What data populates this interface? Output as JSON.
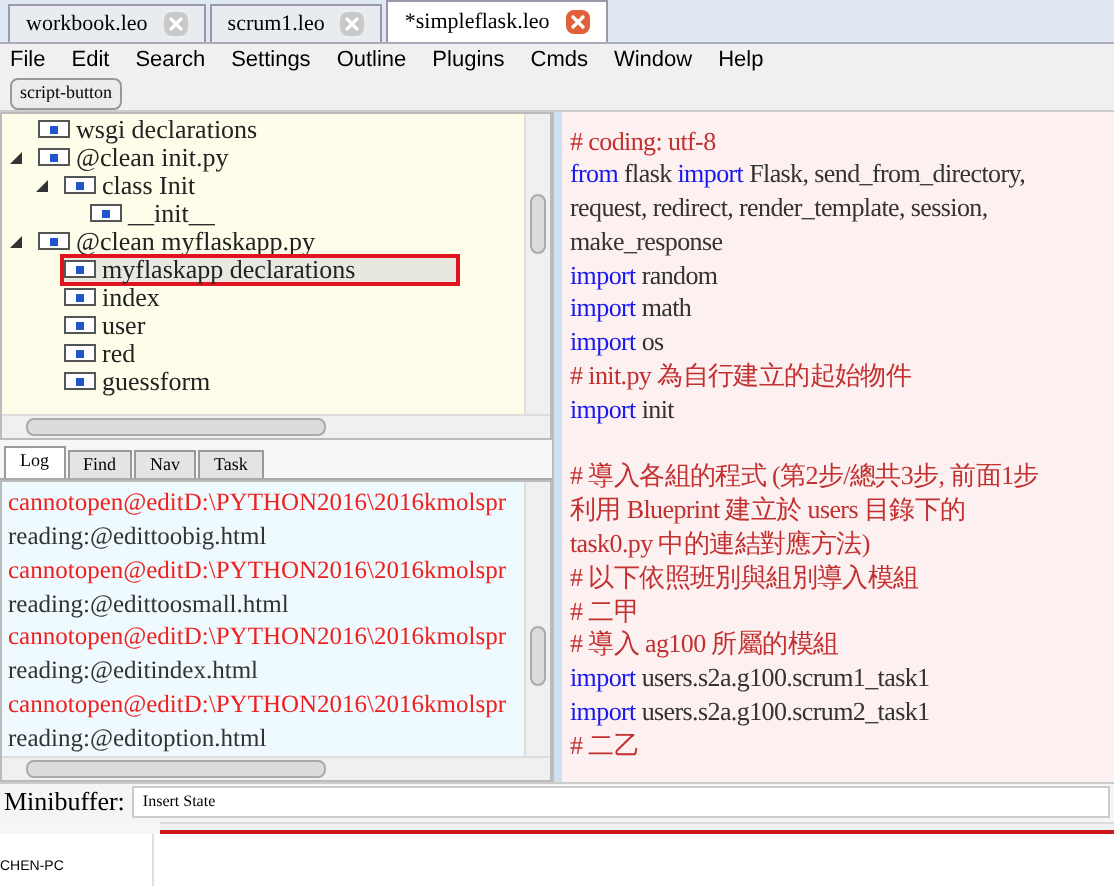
{
  "file_tabs": [
    {
      "label": "workbook.leo",
      "selected": false
    },
    {
      "label": "scrum1.leo",
      "selected": false
    },
    {
      "label": "*simpleflask.leo",
      "selected": true
    }
  ],
  "menu": [
    "File",
    "Edit",
    "Search",
    "Settings",
    "Outline",
    "Plugins",
    "Cmds",
    "Window",
    "Help"
  ],
  "toolbar": {
    "button": "script-button"
  },
  "outline": [
    {
      "label": "wsgi declarations",
      "selected": false
    },
    {
      "label": "@clean init.py",
      "selected": false,
      "expanded": true,
      "children": [
        {
          "label": "class Init",
          "selected": false,
          "expanded": true,
          "children": [
            {
              "label": "__init__",
              "selected": false
            }
          ]
        }
      ]
    },
    {
      "label": "@clean myflaskapp.py",
      "selected": false,
      "expanded": true,
      "children": [
        {
          "label": "myflaskapp declarations",
          "selected": true
        },
        {
          "label": "index",
          "selected": false
        },
        {
          "label": "user",
          "selected": false
        },
        {
          "label": "red",
          "selected": false
        },
        {
          "label": "guessform",
          "selected": false
        }
      ]
    }
  ],
  "log_tabs": [
    {
      "label": "Log",
      "selected": true
    },
    {
      "label": "Find",
      "selected": false
    },
    {
      "label": "Nav",
      "selected": false
    },
    {
      "label": "Task",
      "selected": false
    }
  ],
  "log": [
    {
      "kind": "error",
      "text": "cannotopen@editD:\\PYTHON2016\\2016kmolspr"
    },
    {
      "kind": "info",
      "text": "reading:@edittoobig.html"
    },
    {
      "kind": "error",
      "text": "cannotopen@editD:\\PYTHON2016\\2016kmolspr"
    },
    {
      "kind": "info",
      "text": "reading:@edittoosmall.html"
    },
    {
      "kind": "error",
      "text": "cannotopen@editD:\\PYTHON2016\\2016kmolspr"
    },
    {
      "kind": "info",
      "text": "reading:@editindex.html"
    },
    {
      "kind": "error",
      "text": "cannotopen@editD:\\PYTHON2016\\2016kmolspr"
    },
    {
      "kind": "info",
      "text": "reading:@editoption.html"
    }
  ],
  "code": [
    [
      {
        "kind": "comment",
        "text": "# coding: utf-8"
      }
    ],
    [
      {
        "kind": "keyword",
        "text": "from"
      },
      {
        "kind": "plain",
        "text": " flask "
      },
      {
        "kind": "keyword",
        "text": "import"
      },
      {
        "kind": "plain",
        "text": " Flask, send_from_directory,"
      }
    ],
    [
      {
        "kind": "plain",
        "text": "request, redirect, render_template, session,"
      }
    ],
    [
      {
        "kind": "plain",
        "text": "make_response"
      }
    ],
    [
      {
        "kind": "keyword",
        "text": "import"
      },
      {
        "kind": "plain",
        "text": " random"
      }
    ],
    [
      {
        "kind": "keyword",
        "text": "import"
      },
      {
        "kind": "plain",
        "text": " math"
      }
    ],
    [
      {
        "kind": "keyword",
        "text": "import"
      },
      {
        "kind": "plain",
        "text": " os"
      }
    ],
    [
      {
        "kind": "comment",
        "text": "# init.py 為自行建立的起始物件"
      }
    ],
    [
      {
        "kind": "keyword",
        "text": "import"
      },
      {
        "kind": "plain",
        "text": " init"
      }
    ],
    [
      {
        "kind": "blank"
      },
      {
        "kind": "comment",
        "text": "# 導入各組的程式 (第2步/總共3步, 前面1步"
      }
    ],
    [
      {
        "kind": "comment",
        "text": "利用 Blueprint 建立於 users 目錄下的"
      }
    ],
    [
      {
        "kind": "comment",
        "text": "task0.py 中的連結對應方法)"
      }
    ],
    [
      {
        "kind": "comment",
        "text": "# 以下依照班別與組別導入模組"
      }
    ],
    [
      {
        "kind": "comment",
        "text": "# 二甲"
      }
    ],
    [
      {
        "kind": "comment",
        "text": "# 導入 ag100 所屬的模組"
      }
    ],
    [
      {
        "kind": "keyword",
        "text": "import"
      },
      {
        "kind": "plain",
        "text": " users.s2a.g100.scrum1_task1"
      }
    ],
    [
      {
        "kind": "keyword",
        "text": "import"
      },
      {
        "kind": "plain",
        "text": " users.s2a.g100.scrum2_task1"
      }
    ],
    [
      {
        "kind": "comment",
        "text": "# 二乙"
      }
    ]
  ],
  "minibuffer": {
    "label": "Minibuffer:",
    "value": "Insert State"
  },
  "taskbar": {
    "item": "CHEN-PC"
  }
}
